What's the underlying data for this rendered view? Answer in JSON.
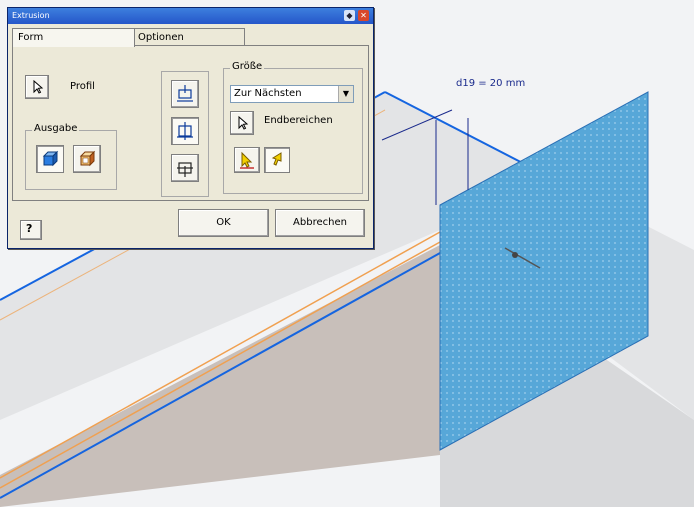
{
  "viewport": {
    "dimension_label": "d19 = 20 mm"
  },
  "dialog": {
    "title": "Extrusion",
    "tabs": [
      {
        "label": "Form"
      },
      {
        "label": "Optionen"
      }
    ],
    "profile_label": "Profil",
    "output": {
      "legend": "Ausgabe"
    },
    "size": {
      "legend": "Größe",
      "extent_value": "Zur Nächsten",
      "endpoint_label": "Endbereichen"
    },
    "ok_label": "OK",
    "cancel_label": "Abbrechen",
    "help_label": "?"
  },
  "colors": {
    "accent": "#2556c9",
    "plane": "#57a7d8",
    "edge_blue": "#1565e0",
    "edge_orange": "#f0a050"
  },
  "icons": {
    "profile": "cursor-arrow-icon",
    "output_solid": "solid-cube-icon",
    "output_surface": "surface-cube-icon",
    "directions": [
      "extrude-direction-up-icon",
      "extrude-direction-symmetric-icon",
      "extrude-direction-down-icon"
    ],
    "endpoint": "cursor-arrow-icon",
    "direction_flip": [
      "direction-flip-a-icon",
      "direction-flip-b-icon"
    ]
  }
}
